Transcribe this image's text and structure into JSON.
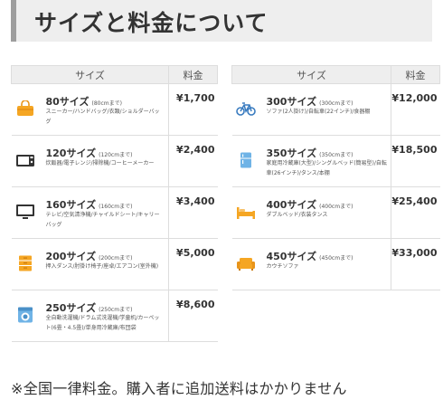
{
  "page_title": "サイズと料金について",
  "table_header": {
    "size_label": "サイズ",
    "price_label": "料金"
  },
  "left_rows": [
    {
      "size": "80サイズ",
      "cm": "(80cmまで)",
      "desc": "スニーカー/ハンドバッグ/衣類/ショルダーバッグ",
      "price": "¥1,700",
      "icon": "bag-icon"
    },
    {
      "size": "120サイズ",
      "cm": "(120cmまで)",
      "desc": "炊飯器/電子レンジ/掃除機/コーヒーメーカー",
      "price": "¥2,400",
      "icon": "microwave-icon"
    },
    {
      "size": "160サイズ",
      "cm": "(160cmまで)",
      "desc": "テレビ/空気清浄機/チャイルドシート/キャリーバッグ",
      "price": "¥3,400",
      "icon": "tv-icon"
    },
    {
      "size": "200サイズ",
      "cm": "(200cmまで)",
      "desc": "押入ダンス/肘掛け椅子/座卓/エアコン(室外機)",
      "price": "¥5,000",
      "icon": "drawer-icon"
    },
    {
      "size": "250サイズ",
      "cm": "(250cmまで)",
      "desc": "全自動洗濯機/ドラム式洗濯機/学童机/カーペット(6畳・4.5畳)/単身用冷蔵庫/布団袋",
      "price": "¥8,600",
      "icon": "washer-icon"
    }
  ],
  "right_rows": [
    {
      "size": "300サイズ",
      "cm": "(300cmまで)",
      "desc": "ソファ(2人掛け)/自転車(22インチ)/食器棚",
      "price": "¥12,000",
      "icon": "bicycle-icon"
    },
    {
      "size": "350サイズ",
      "cm": "(350cmまで)",
      "desc": "家庭用冷蔵庫(大型)/シングルベッド(簡易型)/自転車(26インチ)/タンス/本棚",
      "price": "¥18,500",
      "icon": "fridge-icon"
    },
    {
      "size": "400サイズ",
      "cm": "(400cmまで)",
      "desc": "ダブルベッド/衣装タンス",
      "price": "¥25,400",
      "icon": "bed-icon"
    },
    {
      "size": "450サイズ",
      "cm": "(450cmまで)",
      "desc": "カウチソファ",
      "price": "¥33,000",
      "icon": "sofa-icon"
    }
  ],
  "note": "※全国一律料金。購入者に追加送料はかかりません",
  "colors": {
    "orange": "#f5a623",
    "dark": "#333333",
    "blue": "#4a90c8",
    "header_bg": "#eeeeee"
  }
}
